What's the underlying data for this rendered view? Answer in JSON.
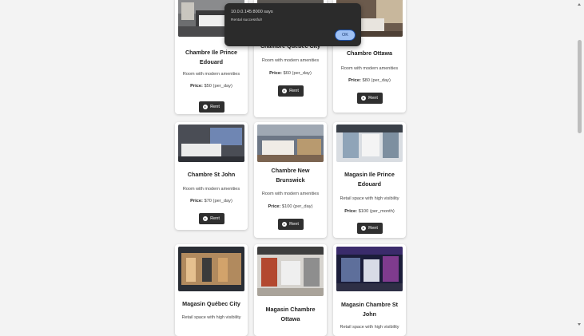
{
  "dialog": {
    "origin": "10.0.0.145:8000 says",
    "message": "Rental successful!",
    "ok_label": "OK"
  },
  "cards": [
    {
      "title": "Chambre Ile Prince Edouard",
      "description": "Room with modern amenities",
      "price_label": "Price:",
      "price_value": "$50 (per_day)",
      "rent_label": "Rent",
      "image": "hotel-room"
    },
    {
      "title": "Chambre Quebec City",
      "description": "Room with modern amenities",
      "price_label": "Price:",
      "price_value": "$60 (per_day)",
      "rent_label": "Rent",
      "image": "hotel-room"
    },
    {
      "title": "Chambre Ottawa",
      "description": "Room with modern amenities",
      "price_label": "Price:",
      "price_value": "$80 (per_day)",
      "rent_label": "Rent",
      "image": "hotel-room"
    },
    {
      "title": "Chambre St John",
      "description": "Room with modern amenities",
      "price_label": "Price:",
      "price_value": "$70 (per_day)",
      "rent_label": "Rent",
      "image": "hotel-room"
    },
    {
      "title": "Chambre New Brunswick",
      "description": "Room with modern amenities",
      "price_label": "Price:",
      "price_value": "$100 (per_day)",
      "rent_label": "Rent",
      "image": "hotel-room"
    },
    {
      "title": "Magasin Ile Prince Edouard",
      "description": "Retail space with high visibility",
      "price_label": "Price:",
      "price_value": "$100 (per_month)",
      "rent_label": "Rent",
      "image": "storefront"
    },
    {
      "title": "Magasin Québec City",
      "description": "Retail space with high visibility",
      "image": "boutique"
    },
    {
      "title": "Magasin Chambre Ottawa",
      "description": "",
      "image": "store-interior"
    },
    {
      "title": "Magasin Chambre St John",
      "description": "Retail space with high visibility",
      "image": "store-night"
    }
  ]
}
